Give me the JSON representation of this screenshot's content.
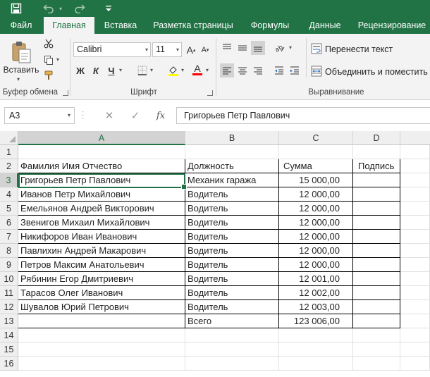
{
  "tabs": [
    "Файл",
    "Главная",
    "Вставка",
    "Разметка страницы",
    "Формулы",
    "Данные",
    "Рецензирование"
  ],
  "ribbon": {
    "paste_label": "Вставить",
    "font_name": "Calibri",
    "font_size": "11",
    "bold": "Ж",
    "italic": "К",
    "underline": "Ч",
    "wrap_text": "Перенести текст",
    "merge_center": "Объединить и поместить в",
    "groups": {
      "clipboard": "Буфер обмена",
      "font": "Шрифт",
      "alignment": "Выравнивание"
    },
    "colors": {
      "highlight": "#ffff00",
      "font_color": "#ff0000",
      "accent": "#217346"
    }
  },
  "formula_bar": {
    "name_box": "A3",
    "fx": "fx",
    "content": "Григорьев Петр Павлович"
  },
  "sheet": {
    "columns": [
      "A",
      "B",
      "C",
      "D"
    ],
    "rows": [
      "1",
      "2",
      "3",
      "4",
      "5",
      "6",
      "7",
      "8",
      "9",
      "10",
      "11",
      "12",
      "13",
      "14",
      "15",
      "16"
    ],
    "header": [
      "Фамилия Имя Отчество",
      "Должность",
      "Сумма",
      "Подпись"
    ],
    "data": [
      [
        "Григорьев Петр Павлович",
        "Механик гаража",
        "15 000,00",
        ""
      ],
      [
        "Иванов Петр Михайлович",
        "Водитель",
        "12 000,00",
        ""
      ],
      [
        "Емельянов Андрей Викторович",
        "Водитель",
        "12 000,00",
        ""
      ],
      [
        "Звенигов Михаил Михайлович",
        "Водитель",
        "12 000,00",
        ""
      ],
      [
        "Никифоров Иван Иванович",
        "Водитель",
        "12 000,00",
        ""
      ],
      [
        "Павлихин Андрей Макарович",
        "Водитель",
        "12 000,00",
        ""
      ],
      [
        "Петров Максим Анатольевич",
        "Водитель",
        "12 000,00",
        ""
      ],
      [
        "Рябинин Егор Дмитриевич",
        "Водитель",
        "12 001,00",
        ""
      ],
      [
        "Тарасов Олег Иванович",
        "Водитель",
        "12 002,00",
        ""
      ],
      [
        "Шувалов Юрий Петрович",
        "Водитель",
        "12 003,00",
        ""
      ]
    ],
    "total": [
      "",
      "Всего",
      "123 006,00",
      ""
    ],
    "selected_cell": "A3"
  }
}
